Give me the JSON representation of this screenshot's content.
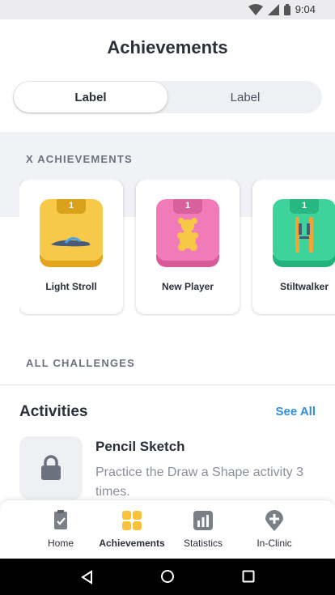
{
  "status_bar": {
    "time": "9:04"
  },
  "header": {
    "title": "Achievements"
  },
  "segmented_control": {
    "tabs": [
      {
        "label": "Label",
        "active": true
      },
      {
        "label": "Label",
        "active": false
      }
    ]
  },
  "achievements": {
    "section_label": "X ACHIEVEMENTS",
    "cards": [
      {
        "label": "Light Stroll",
        "level": "1",
        "color": "#f7c948",
        "icon": "sandal-icon"
      },
      {
        "label": "New Player",
        "level": "1",
        "color": "#f17bb8",
        "icon": "gummy-bear-icon"
      },
      {
        "label": "Stiltwalker",
        "level": "1",
        "color": "#3ed39a",
        "icon": "stilts-icon"
      }
    ]
  },
  "challenges": {
    "section_label": "ALL CHALLENGES"
  },
  "activities": {
    "title": "Activities",
    "see_all_label": "See All",
    "items": [
      {
        "title": "Pencil Sketch",
        "description": "Practice the Draw a Shape activity 3 times.",
        "locked": true
      }
    ]
  },
  "tabbar": {
    "items": [
      {
        "label": "Home",
        "icon": "clipboard-check-icon",
        "active": false
      },
      {
        "label": "Achievements",
        "icon": "achievements-grid-icon",
        "active": true
      },
      {
        "label": "Statistics",
        "icon": "bar-chart-icon",
        "active": false
      },
      {
        "label": "In-Clinic",
        "icon": "location-plus-icon",
        "active": false
      }
    ]
  },
  "colors": {
    "accent": "#2f8fe0",
    "active_tab": "#f8c23a",
    "inactive_icon": "#7b7f88"
  }
}
